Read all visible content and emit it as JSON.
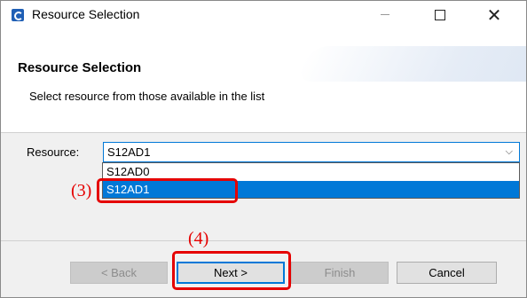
{
  "window": {
    "title": "Resource Selection",
    "icon": "app-logo-icon",
    "controls": [
      "minimize-icon",
      "maximize-icon",
      "close-icon"
    ]
  },
  "header": {
    "title": "Resource Selection",
    "description": "Select resource from those available in the list"
  },
  "resource": {
    "label": "Resource:",
    "selected": "S12AD1",
    "options": [
      "S12AD0",
      "S12AD1"
    ],
    "highlighted_option": "S12AD1"
  },
  "buttons": {
    "back": "< Back",
    "next": "Next >",
    "finish": "Finish",
    "cancel": "Cancel"
  },
  "annotations": {
    "step3": "(3)",
    "step4": "(4)",
    "color": "#e50000"
  },
  "colors": {
    "accent": "#0078d7",
    "selection_bg": "#0078d7"
  }
}
